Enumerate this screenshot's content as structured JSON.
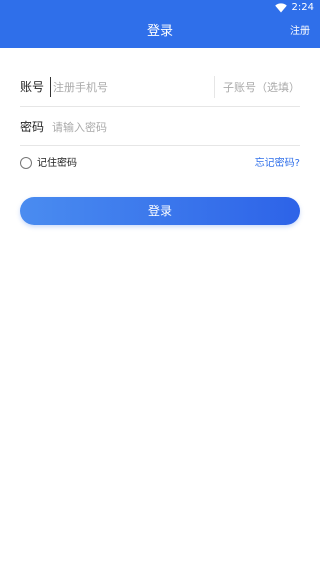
{
  "status_bar": {
    "time": "2:24",
    "wifi_icon": "wifi-icon"
  },
  "app_bar": {
    "title": "登录",
    "register_label": "注册"
  },
  "form": {
    "account": {
      "label": "账号",
      "placeholder": "注册手机号",
      "sub_placeholder": "子账号（选填）"
    },
    "password": {
      "label": "密码",
      "placeholder": "请输入密码"
    }
  },
  "remember": {
    "label": "记住密码",
    "forgot_label": "忘记密码?"
  },
  "login_button": {
    "label": "登录"
  },
  "colors": {
    "primary": "#2f6fea",
    "gradient_start": "#4a8cf0",
    "gradient_end": "#2d63e8",
    "divider": "#e6e6e6"
  }
}
